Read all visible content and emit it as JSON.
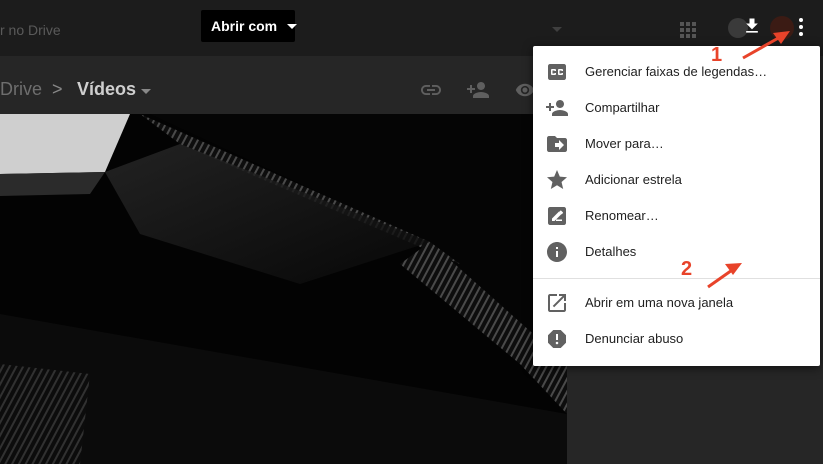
{
  "topbar": {
    "search_text": "r no Drive",
    "open_with_label": "Abrir com",
    "icons": [
      "apps-icon",
      "download-icon",
      "more-vert-icon"
    ]
  },
  "breadcrumb": {
    "root": "Drive",
    "separator": ">",
    "current": "Vídeos"
  },
  "menu": {
    "items": [
      {
        "label": "Gerenciar faixas de legendas…",
        "icon": "closed-caption-icon"
      },
      {
        "label": "Compartilhar",
        "icon": "person-add-icon"
      },
      {
        "label": "Mover para…",
        "icon": "move-to-folder-icon"
      },
      {
        "label": "Adicionar estrela",
        "icon": "star-icon"
      },
      {
        "label": "Renomear…",
        "icon": "rename-pencil-icon"
      },
      {
        "label": "Detalhes",
        "icon": "info-icon"
      },
      {
        "label": "Abrir em uma nova janela",
        "icon": "open-in-new-icon"
      },
      {
        "label": "Denunciar abuso",
        "icon": "report-icon"
      }
    ]
  },
  "annotations": {
    "step1": "1",
    "step2": "2",
    "color": "#e8432a"
  }
}
